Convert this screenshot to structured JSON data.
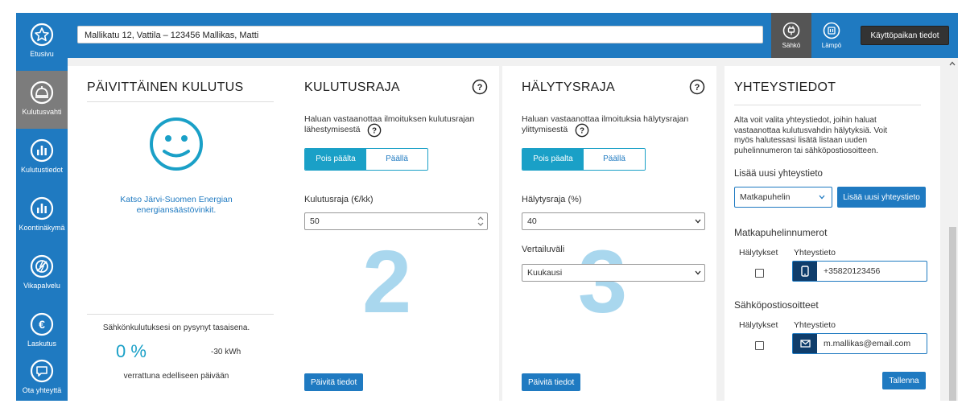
{
  "sidebar": {
    "items": [
      {
        "label": "Etusivu",
        "icon": "star-icon"
      },
      {
        "label": "Kulutusvahti",
        "icon": "bell-icon"
      },
      {
        "label": "Kulutustiedot",
        "icon": "bar-chart-icon"
      },
      {
        "label": "Koontinäkymä",
        "icon": "bar-chart-icon"
      },
      {
        "label": "Vikapalvelu",
        "icon": "no-lightning-icon"
      },
      {
        "label": "Laskutus",
        "icon": "euro-icon"
      },
      {
        "label": "Ota yhteyttä",
        "icon": "chat-icon"
      }
    ]
  },
  "header": {
    "address": "Mallikatu 12, Vattila – 123456 Mallikas, Matti",
    "tabs": [
      {
        "label": "Sähkö",
        "icon": "plug-icon"
      },
      {
        "label": "Lämpö",
        "icon": "heat-icon"
      }
    ],
    "info_button": "Käyttöpaikan tiedot"
  },
  "daily": {
    "title": "PÄIVITTÄINEN KULUTUS",
    "tip_line1": "Katso Järvi-Suomen Energian",
    "tip_line2": "energiansäästövinkit.",
    "summary": "Sähkönkulutuksesi on pysynyt tasaisena.",
    "percent": "0 %",
    "kwh": "-30 kWh",
    "compare": "verrattuna edelliseen päivään"
  },
  "limit": {
    "title": "KULUTUSRAJA",
    "desc_line1": "Haluan vastaanottaa ilmoituksen kulutusrajan",
    "desc_line2": "lähestymisestä",
    "toggle_off": "Pois päälta",
    "toggle_on": "Päällä",
    "field_label": "Kulutusraja  (€/kk)",
    "value": "50",
    "number": "2",
    "update_button": "Päivitä tiedot"
  },
  "alarm": {
    "title": "HÄLYTYSRAJA",
    "desc_line1": "Haluan vastaanottaa ilmoituksia hälytysrajan",
    "desc_line2": "ylittymisestä",
    "toggle_off": "Pois päalta",
    "toggle_on": "Päällä",
    "field_label": "Hälytysraja  (%)",
    "value": "40",
    "period_label": "Vertailuväli",
    "period_value": "Kuukausi",
    "number": "3",
    "update_button": "Päivitä tiedot"
  },
  "contact": {
    "title": "YHTEYSTIEDOT",
    "desc_line1": "Alta voit valita yhteystiedot, joihin haluat",
    "desc_line2": "vastaanottaa kulutusvahdin hälytyksiä. Voit",
    "desc_line3": "myös halutessasi lisätä listaan uuden",
    "desc_line4": "puhelinnumeron tai sähköpostiosoitteen.",
    "add_label": "Lisää uusi yhteystieto",
    "type_value": "Matkapuhelin",
    "add_button": "Lisää uusi yhteystieto",
    "phones_heading": "Matkapuhelinnumerot",
    "col_alarms": "Hälytykset",
    "col_contact": "Yhteystieto",
    "phone": "+35820123456",
    "emails_heading": "Sähköpostiosoitteet",
    "email": "m.mallikas@email.com",
    "save_button": "Tallenna"
  },
  "colors": {
    "brand": "#1f7ac1",
    "accent": "#1aa0c7",
    "dark": "#333333",
    "watermark": "#a9d7ee"
  }
}
